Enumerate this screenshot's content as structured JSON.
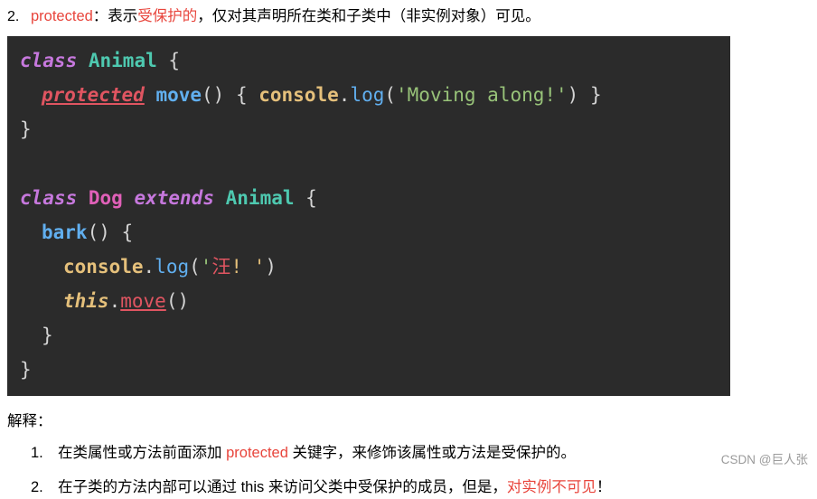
{
  "top_item": {
    "number": "2.",
    "segments": [
      {
        "text": "protected",
        "style": "kw-red"
      },
      {
        "text": "：表示",
        "style": "plain"
      },
      {
        "text": "受保护的",
        "style": "cn-red"
      },
      {
        "text": "，仅对其声明所在类和子类中（非实例对象）可见。",
        "style": "plain"
      }
    ]
  },
  "code": {
    "lines": [
      [
        {
          "t": "class",
          "c": "c-class"
        },
        {
          "t": " ",
          "c": "c-punc"
        },
        {
          "t": "Animal",
          "c": "c-type"
        },
        {
          "t": " {",
          "c": "c-punc"
        }
      ],
      [
        {
          "t": "protected",
          "c": "c-prot"
        },
        {
          "t": " ",
          "c": "c-punc"
        },
        {
          "t": "move",
          "c": "c-method"
        },
        {
          "t": "() { ",
          "c": "c-punc"
        },
        {
          "t": "console",
          "c": "c-obj"
        },
        {
          "t": ".",
          "c": "c-punc"
        },
        {
          "t": "log",
          "c": "c-fn"
        },
        {
          "t": "(",
          "c": "c-punc"
        },
        {
          "t": "'Moving along!'",
          "c": "c-str"
        },
        {
          "t": ") }",
          "c": "c-punc"
        }
      ],
      [
        {
          "t": "}",
          "c": "c-punc"
        }
      ],
      [
        {
          "t": "",
          "c": "c-punc"
        }
      ],
      [
        {
          "t": "class",
          "c": "c-class"
        },
        {
          "t": " ",
          "c": "c-punc"
        },
        {
          "t": "Dog",
          "c": "c-dogtype"
        },
        {
          "t": " ",
          "c": "c-punc"
        },
        {
          "t": "extends",
          "c": "c-ext"
        },
        {
          "t": " ",
          "c": "c-punc"
        },
        {
          "t": "Animal",
          "c": "c-type"
        },
        {
          "t": " {",
          "c": "c-punc"
        }
      ],
      [
        {
          "t": "bark",
          "c": "c-method"
        },
        {
          "t": "() {",
          "c": "c-punc"
        }
      ],
      [
        {
          "t": "console",
          "c": "c-obj"
        },
        {
          "t": ".",
          "c": "c-punc"
        },
        {
          "t": "log",
          "c": "c-fn"
        },
        {
          "t": "(",
          "c": "c-punc"
        },
        {
          "t": "'",
          "c": "c-str"
        },
        {
          "t": "汪",
          "c": "c-cn"
        },
        {
          "t": "! '",
          "c": "c-str-y"
        },
        {
          "t": ")",
          "c": "c-punc"
        }
      ],
      [
        {
          "t": "this",
          "c": "c-this"
        },
        {
          "t": ".",
          "c": "c-punc"
        },
        {
          "t": "move",
          "c": "c-move"
        },
        {
          "t": "()",
          "c": "c-punc"
        }
      ],
      [
        {
          "t": "}",
          "c": "c-punc"
        }
      ],
      [
        {
          "t": "}",
          "c": "c-punc"
        }
      ]
    ],
    "indents": [
      0,
      1,
      0,
      0,
      0,
      1,
      2,
      2,
      1,
      0
    ]
  },
  "explanation": {
    "label": "解释：",
    "items": [
      {
        "number": "1.",
        "segments": [
          {
            "text": "在类属性或方法前面添加 ",
            "style": "plain"
          },
          {
            "text": "protected",
            "style": "kw-red"
          },
          {
            "text": " 关键字，来修饰该属性或方法是受保护的。",
            "style": "plain"
          }
        ]
      },
      {
        "number": "2.",
        "segments": [
          {
            "text": "在子类的方法内部可以通过 this 来访问父类中受保护的成员，但是，",
            "style": "plain"
          },
          {
            "text": "对实例不可见",
            "style": "cn-red"
          },
          {
            "text": "！",
            "style": "plain"
          }
        ]
      }
    ]
  },
  "watermark": "CSDN @巨人张"
}
